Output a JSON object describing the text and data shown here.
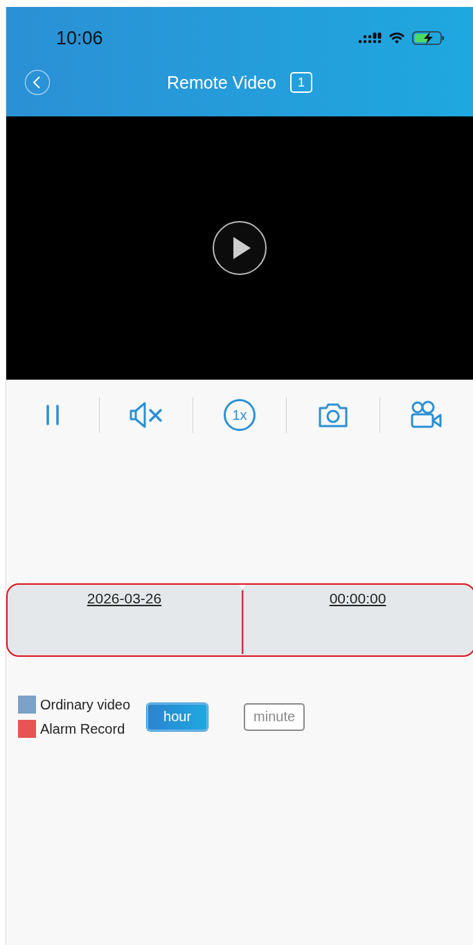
{
  "status_bar": {
    "time": "10:06"
  },
  "header": {
    "title": "Remote Video",
    "channel": "1"
  },
  "toolbar": [
    {
      "kind": "pause"
    },
    {
      "kind": "mute"
    },
    {
      "kind": "speed",
      "label": "1x"
    },
    {
      "kind": "snapshot"
    },
    {
      "kind": "record"
    }
  ],
  "timeline": {
    "date": "2026-03-26",
    "time": "00:00:00"
  },
  "legend": [
    {
      "label": "Ordinary video",
      "color": "#7ba2c9"
    },
    {
      "label": "Alarm Record",
      "color": "#e85454"
    }
  ],
  "scale": [
    {
      "label": "hour",
      "selected": true
    },
    {
      "label": "minute",
      "selected": false
    }
  ]
}
